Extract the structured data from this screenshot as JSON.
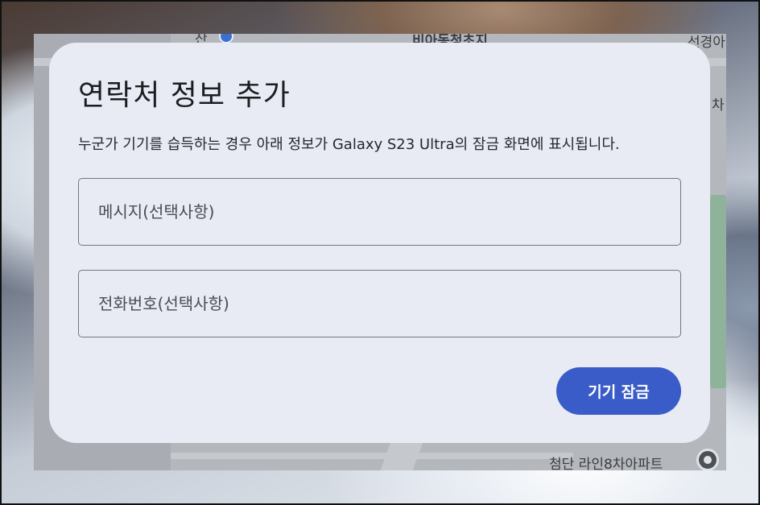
{
  "map": {
    "labels": {
      "top_center": "비아동청초지",
      "top_right": "선경아",
      "right_edge": "차",
      "bottom_right": "첨단 라인8차아파트",
      "top_left": "잔"
    }
  },
  "dialog": {
    "title": "연락처 정보 추가",
    "description": "누군가 기기를 습득하는 경우 아래 정보가 Galaxy S23 Ultra의 잠금 화면에 표시됩니다.",
    "message_field": {
      "placeholder": "메시지(선택사항)",
      "value": ""
    },
    "phone_field": {
      "placeholder": "전화번호(선택사항)",
      "value": ""
    },
    "lock_button_label": "기기 잠금"
  },
  "colors": {
    "dialog_bg": "#e8ebf4",
    "accent": "#3a5cc8",
    "map_bg": "#a9adb3"
  }
}
